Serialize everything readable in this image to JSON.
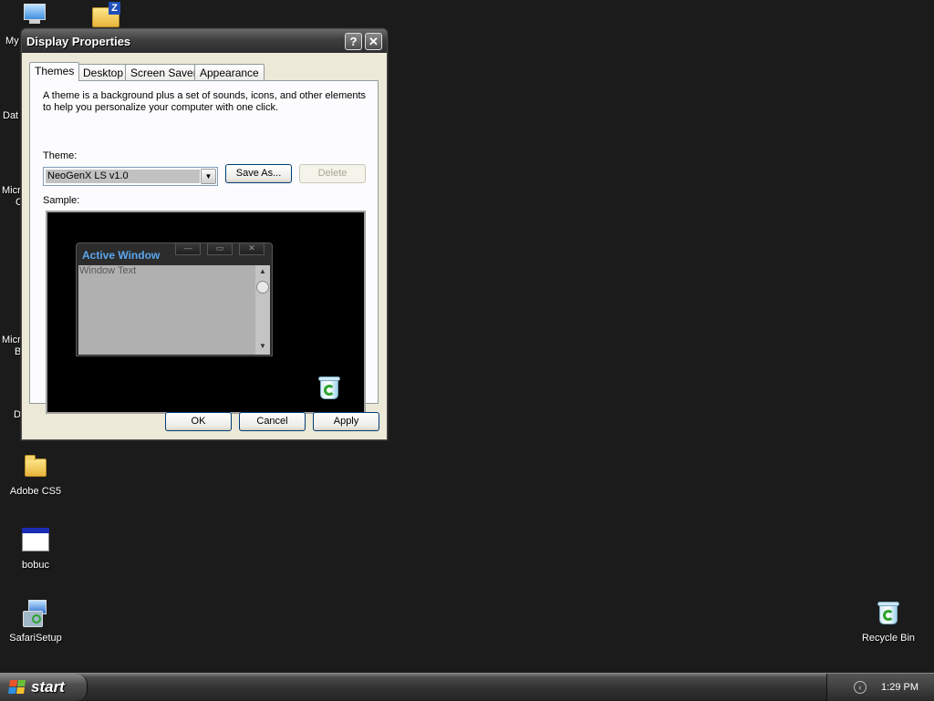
{
  "desktop": {
    "icons": [
      {
        "label": "Adobe CS5"
      },
      {
        "label": "bobuc"
      },
      {
        "label": "SafariSetup"
      },
      {
        "label": "Recycle Bin"
      }
    ],
    "partial_labels": [
      "My",
      "Dat",
      "Micro",
      "C",
      "Micro",
      "B",
      "D"
    ]
  },
  "window": {
    "title": "Display Properties",
    "help_glyph": "?",
    "close_glyph": "✕",
    "tabs": [
      {
        "label": "Themes",
        "active": true
      },
      {
        "label": "Desktop"
      },
      {
        "label": "Screen Saver"
      },
      {
        "label": "Appearance"
      }
    ],
    "description": "A theme is a background plus a set of sounds, icons, and other elements to help you personalize your computer with one click.",
    "theme_label": "Theme:",
    "theme_value": "NeoGenX LS v1.0",
    "save_as": "Save As...",
    "delete": "Delete",
    "sample_label": "Sample:",
    "preview": {
      "title": "Active Window",
      "text": "Window Text"
    },
    "ok": "OK",
    "cancel": "Cancel",
    "apply": "Apply"
  },
  "taskbar": {
    "start": "start",
    "time": "1:29 PM"
  },
  "colors": {
    "desktop_bg": "#1b1b1b",
    "preview_title": "#5aa7ee"
  }
}
